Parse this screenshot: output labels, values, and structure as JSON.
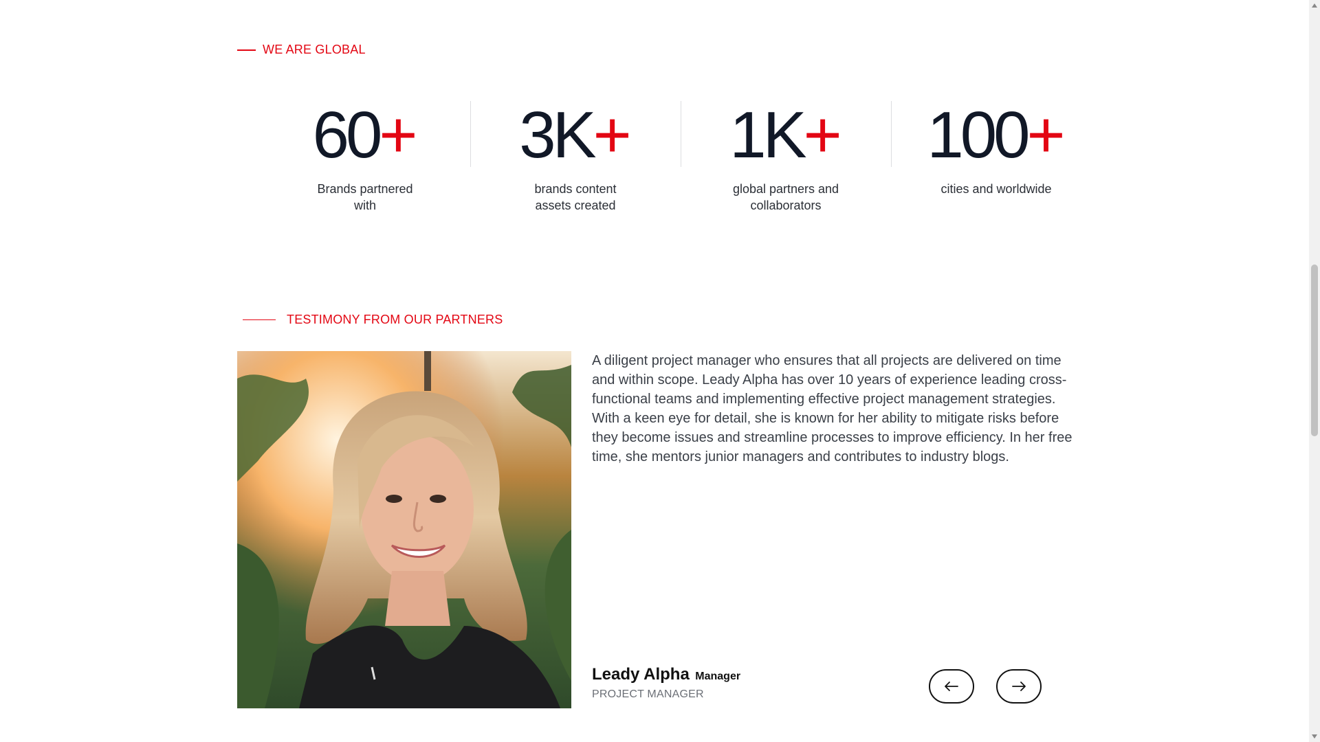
{
  "global_section": {
    "label": "WE ARE GLOBAL",
    "stats": [
      {
        "number": "60",
        "suffix": "+",
        "description": "Brands partnered with"
      },
      {
        "number": "3K",
        "suffix": "+",
        "description": "brands content assets created"
      },
      {
        "number": "1K",
        "suffix": "+",
        "description": "global partners and collaborators"
      },
      {
        "number": "100",
        "suffix": "+",
        "description": "cities and worldwide"
      }
    ]
  },
  "testimony_section": {
    "label": "TESTIMONY FROM OUR PARTNERS",
    "quote": "A diligent project manager who ensures that all projects are delivered on time and within scope. Leady Alpha has over 10 years of experience leading cross-functional teams and implementing effective project management strategies. With a keen eye for detail, she is known for her ability to mitigate risks before they become issues and streamline processes to improve efficiency. In her free time, she mentors junior managers and contributes to industry blogs.",
    "author": {
      "name": "Leady Alpha",
      "role": "Manager",
      "title": "PROJECT MANAGER"
    },
    "nav": {
      "prev_icon": "arrow-left-icon",
      "next_icon": "arrow-right-icon"
    }
  },
  "colors": {
    "accent": "#e30613",
    "text_dark": "#111827",
    "text_body": "#3a3f47",
    "text_muted": "#6b6f76"
  }
}
